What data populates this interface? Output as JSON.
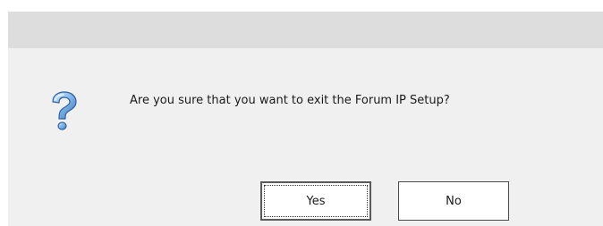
{
  "dialog": {
    "message": "Are you sure that you want to exit the Forum IP Setup?",
    "icon": "question-icon",
    "buttons": {
      "yes_label": "Yes",
      "no_label": "No"
    }
  },
  "colors": {
    "title_bar": "#dddddd",
    "body": "#f0f0f0",
    "icon_fill": "#7fb3e6"
  }
}
